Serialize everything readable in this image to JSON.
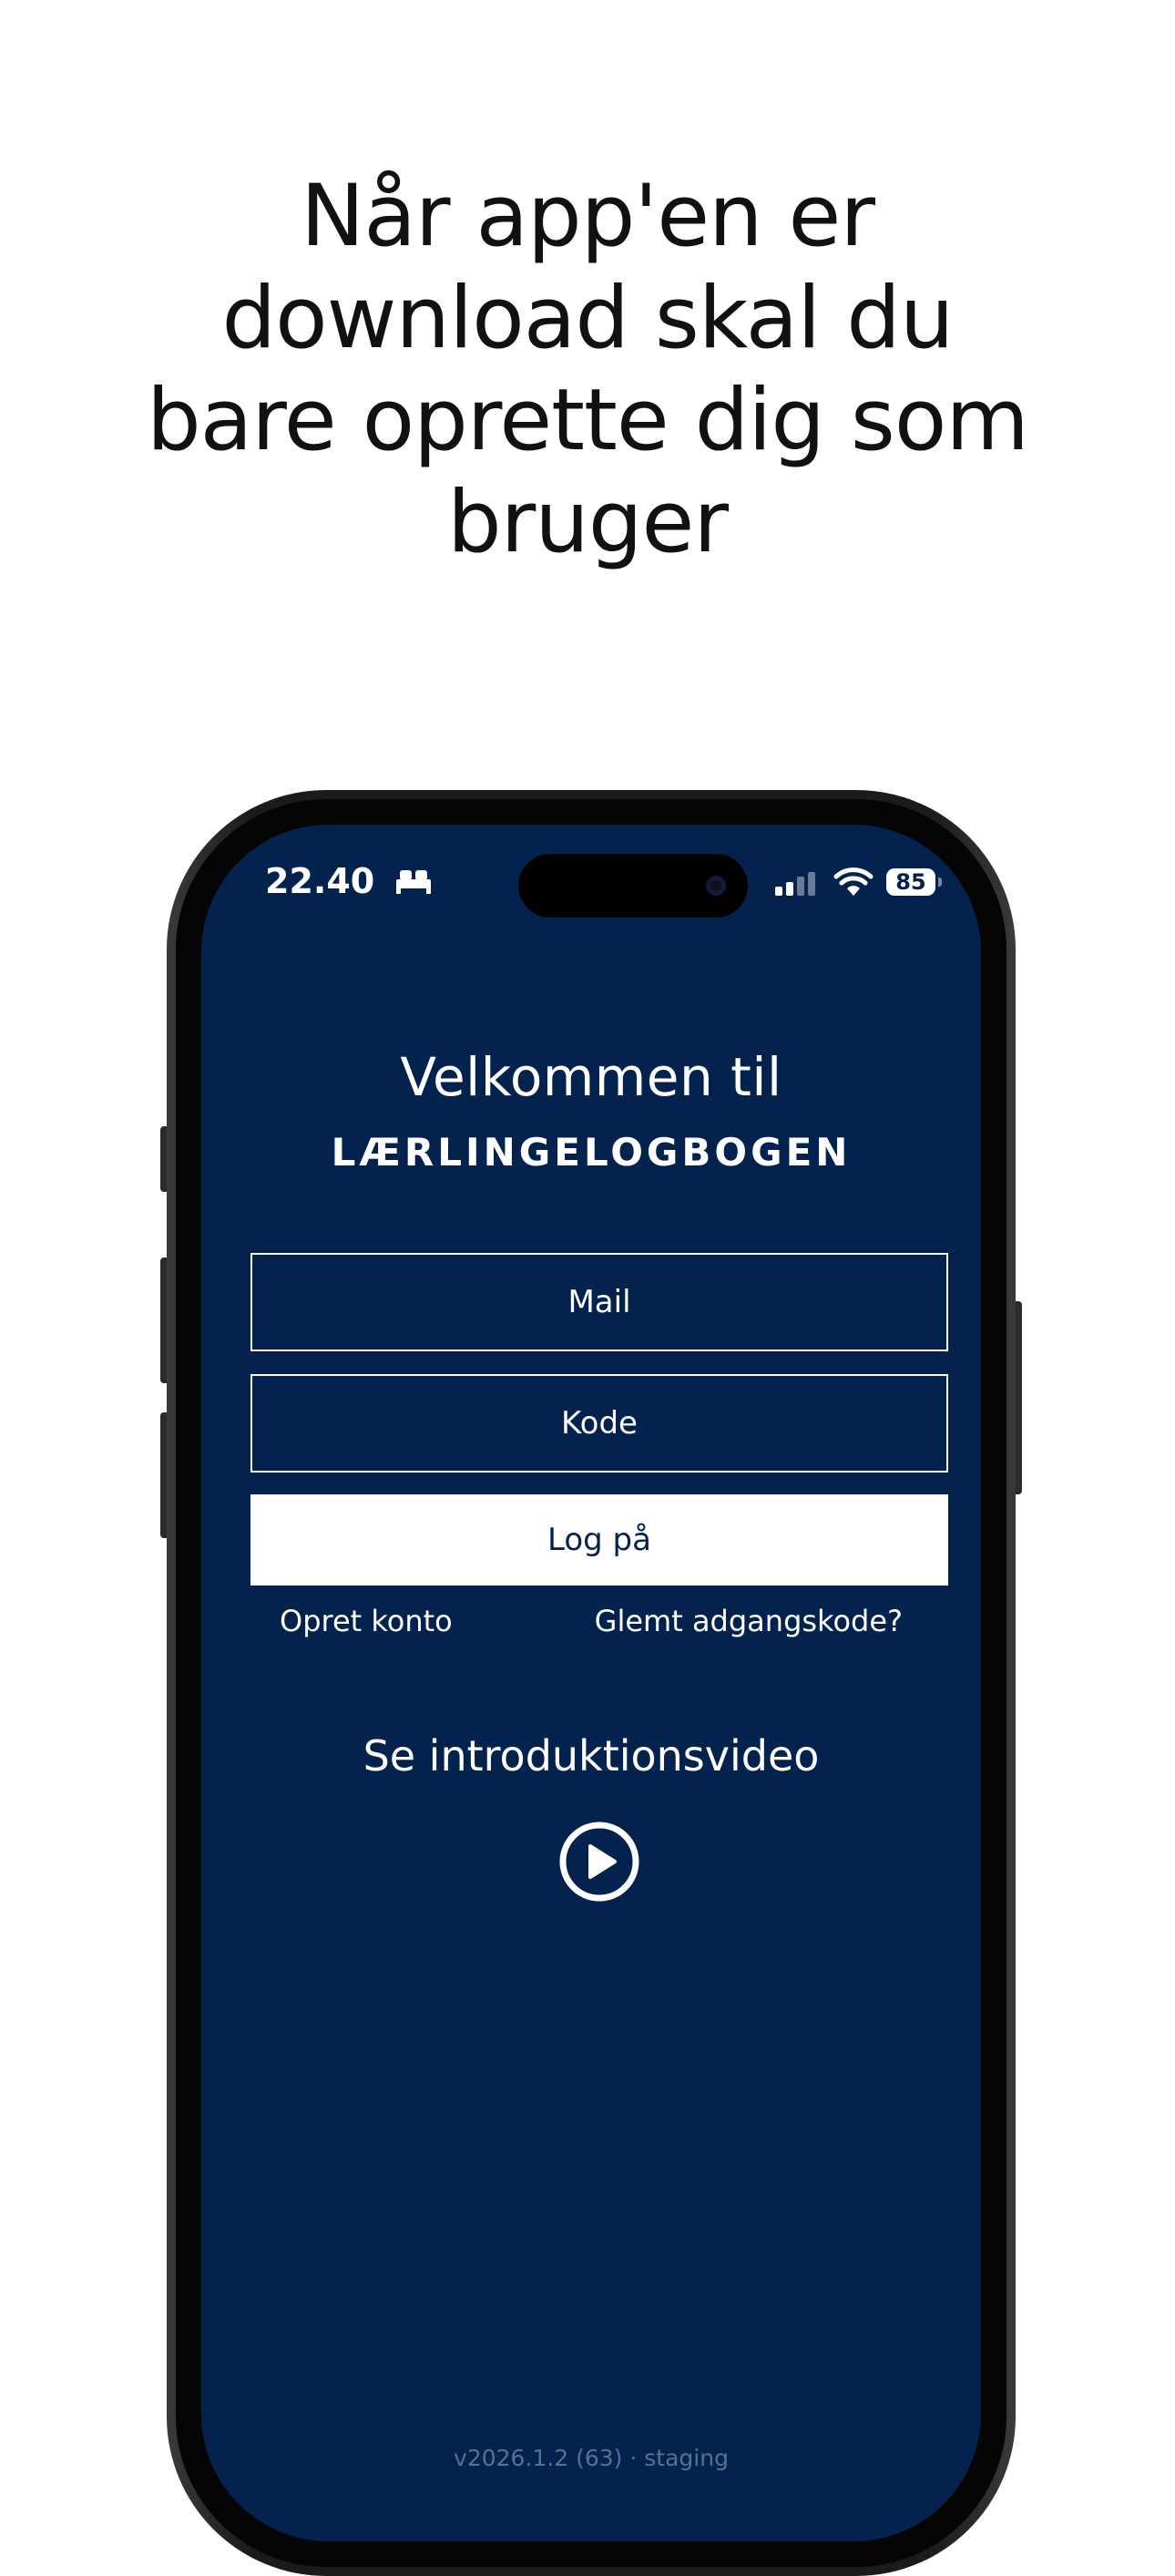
{
  "headline": {
    "lines": [
      "Når app'en er",
      "download skal du",
      "bare oprette dig som",
      "bruger"
    ]
  },
  "status_bar": {
    "time": "22.40",
    "battery": "85",
    "icons": [
      "bed-icon",
      "signal-icon",
      "wifi-icon",
      "battery-icon"
    ]
  },
  "login": {
    "welcome": "Velkommen til",
    "app_name": "LÆRLINGELOGBOGEN",
    "mail_placeholder": "Mail",
    "code_placeholder": "Kode",
    "login_button": "Log på",
    "create_account": "Opret konto",
    "forgot_password": "Glemt adgangskode?",
    "video_title": "Se introduktionsvideo",
    "version": "v2026.1.2 (63) · staging"
  },
  "colors": {
    "screen_background": "#03234e",
    "text_on_dark": "#ffffff",
    "headline_text": "#111111"
  }
}
